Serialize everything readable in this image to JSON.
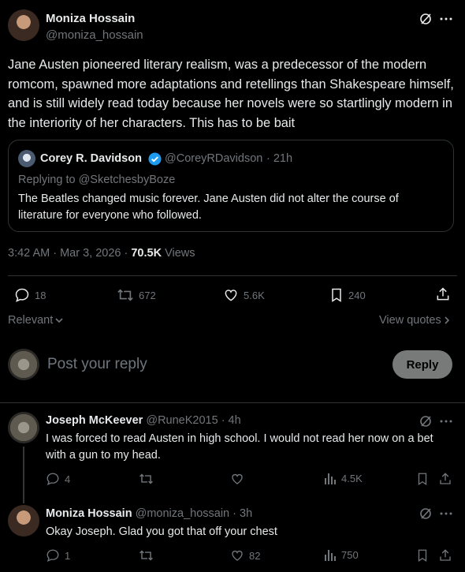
{
  "main_post": {
    "author_name": "Moniza Hossain",
    "author_handle": "@moniza_hossain",
    "text": "Jane Austen pioneered literary realism, was a predecessor of the modern romcom, spawned more adaptations and retellings than Shakespeare himself, and is still widely read today because her novels were so startlingly modern in the interiority of her characters. This has to be bait",
    "quoted": {
      "author_name": "Corey R. Davidson",
      "author_handle": "@CoreyRDavidson",
      "time": "· 21h",
      "replying_to": "Replying to @SketchesbyBoze",
      "text": "The Beatles changed music forever. Jane Austen did not alter the course of literature for everyone who followed."
    },
    "meta": {
      "timestamp": "3:42 AM · Mar 3, 2026 ·",
      "views_count": "70.5K",
      "views_label": "Views"
    },
    "actions": {
      "replies": "18",
      "reposts": "672",
      "likes": "5.6K",
      "bookmarks": "240"
    }
  },
  "sort": {
    "label": "Relevant",
    "view_quotes": "View quotes"
  },
  "composer": {
    "placeholder": "Post your reply",
    "reply_button": "Reply"
  },
  "replies": [
    {
      "author_name": "Joseph McKeever",
      "author_handle": "@RuneK2015",
      "time": "· 4h",
      "text": "I was forced to read Austen in high school. I would not read her now on a bet with a gun to my head.",
      "replies": "4",
      "reposts": "",
      "likes": "",
      "views": "4.5K"
    },
    {
      "author_name": "Moniza Hossain",
      "author_handle": "@moniza_hossain",
      "time": "· 3h",
      "text": "Okay Joseph. Glad you got that off your chest",
      "replies": "1",
      "reposts": "",
      "likes": "82",
      "views": "750"
    }
  ],
  "colors": {
    "background": "#000000",
    "text": "#e7e9ea",
    "muted": "#71767b",
    "verified": "#1d9bf0",
    "border": "#2f3336",
    "reply_button_bg": "#787a7a"
  }
}
